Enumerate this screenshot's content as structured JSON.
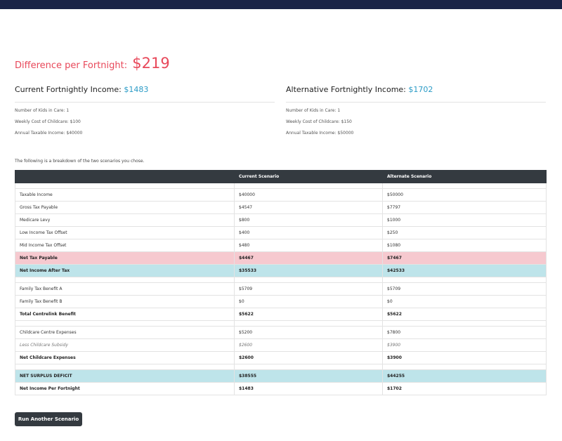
{
  "colors": {
    "header_bar": "#1a2447",
    "difference": "#e8485a",
    "amount": "#2a9bc6",
    "table_header": "#343a40",
    "highlight_pink": "#f6c9cf",
    "highlight_cyan": "#bee4ea"
  },
  "difference": {
    "label": "Difference per Fortnight:",
    "value": "$219"
  },
  "current": {
    "title": "Current Fortnightly Income:",
    "amount": "$1483",
    "details": [
      "Number of Kids in Care: 1",
      "Weekly Cost of Childcare: $100",
      "Annual Taxable Income: $40000"
    ]
  },
  "alternative": {
    "title": "Alternative Fortnightly Income:",
    "amount": "$1702",
    "details": [
      "Number of Kids in Care: 1",
      "Weekly Cost of Childcare: $150",
      "Annual Taxable Income: $50000"
    ]
  },
  "breakdown": {
    "intro": "The following is a breakdown of the two scenarios you chose.",
    "headers": [
      "",
      "Current Scenario",
      "Alternate Scenario"
    ],
    "rows": [
      {
        "cells": [
          "",
          "",
          ""
        ],
        "style": "spacer"
      },
      {
        "cells": [
          "Taxable Income",
          "$40000",
          "$50000"
        ],
        "style": ""
      },
      {
        "cells": [
          "Gross Tax Payable",
          "$4547",
          "$7797"
        ],
        "style": ""
      },
      {
        "cells": [
          "Medicare Levy",
          "$800",
          "$1000"
        ],
        "style": ""
      },
      {
        "cells": [
          "Low Income Tax Offset",
          "$400",
          "$250"
        ],
        "style": ""
      },
      {
        "cells": [
          "Mid Income Tax Offset",
          "$480",
          "$1080"
        ],
        "style": ""
      },
      {
        "cells": [
          "Net Tax Payable",
          "$4467",
          "$7467"
        ],
        "style": "bold pink"
      },
      {
        "cells": [
          "Net Income After Tax",
          "$35533",
          "$42533"
        ],
        "style": "bold cyan"
      },
      {
        "cells": [
          "",
          "",
          ""
        ],
        "style": "spacer"
      },
      {
        "cells": [
          "Family Tax Benefit A",
          "$5709",
          "$5709"
        ],
        "style": ""
      },
      {
        "cells": [
          "Family Tax Benefit B",
          "$0",
          "$0"
        ],
        "style": ""
      },
      {
        "cells": [
          "Total Centrelink Benefit",
          "$5622",
          "$5622"
        ],
        "style": "bold"
      },
      {
        "cells": [
          "",
          "",
          ""
        ],
        "style": "spacer"
      },
      {
        "cells": [
          "Childcare Centre Expenses",
          "$5200",
          "$7800"
        ],
        "style": ""
      },
      {
        "cells": [
          "Less Childcare Subsidy",
          "$2600",
          "$3900"
        ],
        "style": "italic"
      },
      {
        "cells": [
          "Net Childcare Expenses",
          "$2600",
          "$3900"
        ],
        "style": "bold"
      },
      {
        "cells": [
          "",
          "",
          ""
        ],
        "style": "spacer"
      },
      {
        "cells": [
          "NET SURPLUS DEFICIT",
          "$38555",
          "$44255"
        ],
        "style": "bold cyan"
      },
      {
        "cells": [
          "Net Income Per Fortnight",
          "$1483",
          "$1702"
        ],
        "style": "bold"
      }
    ]
  },
  "button": {
    "label": "Run Another Scenario"
  }
}
